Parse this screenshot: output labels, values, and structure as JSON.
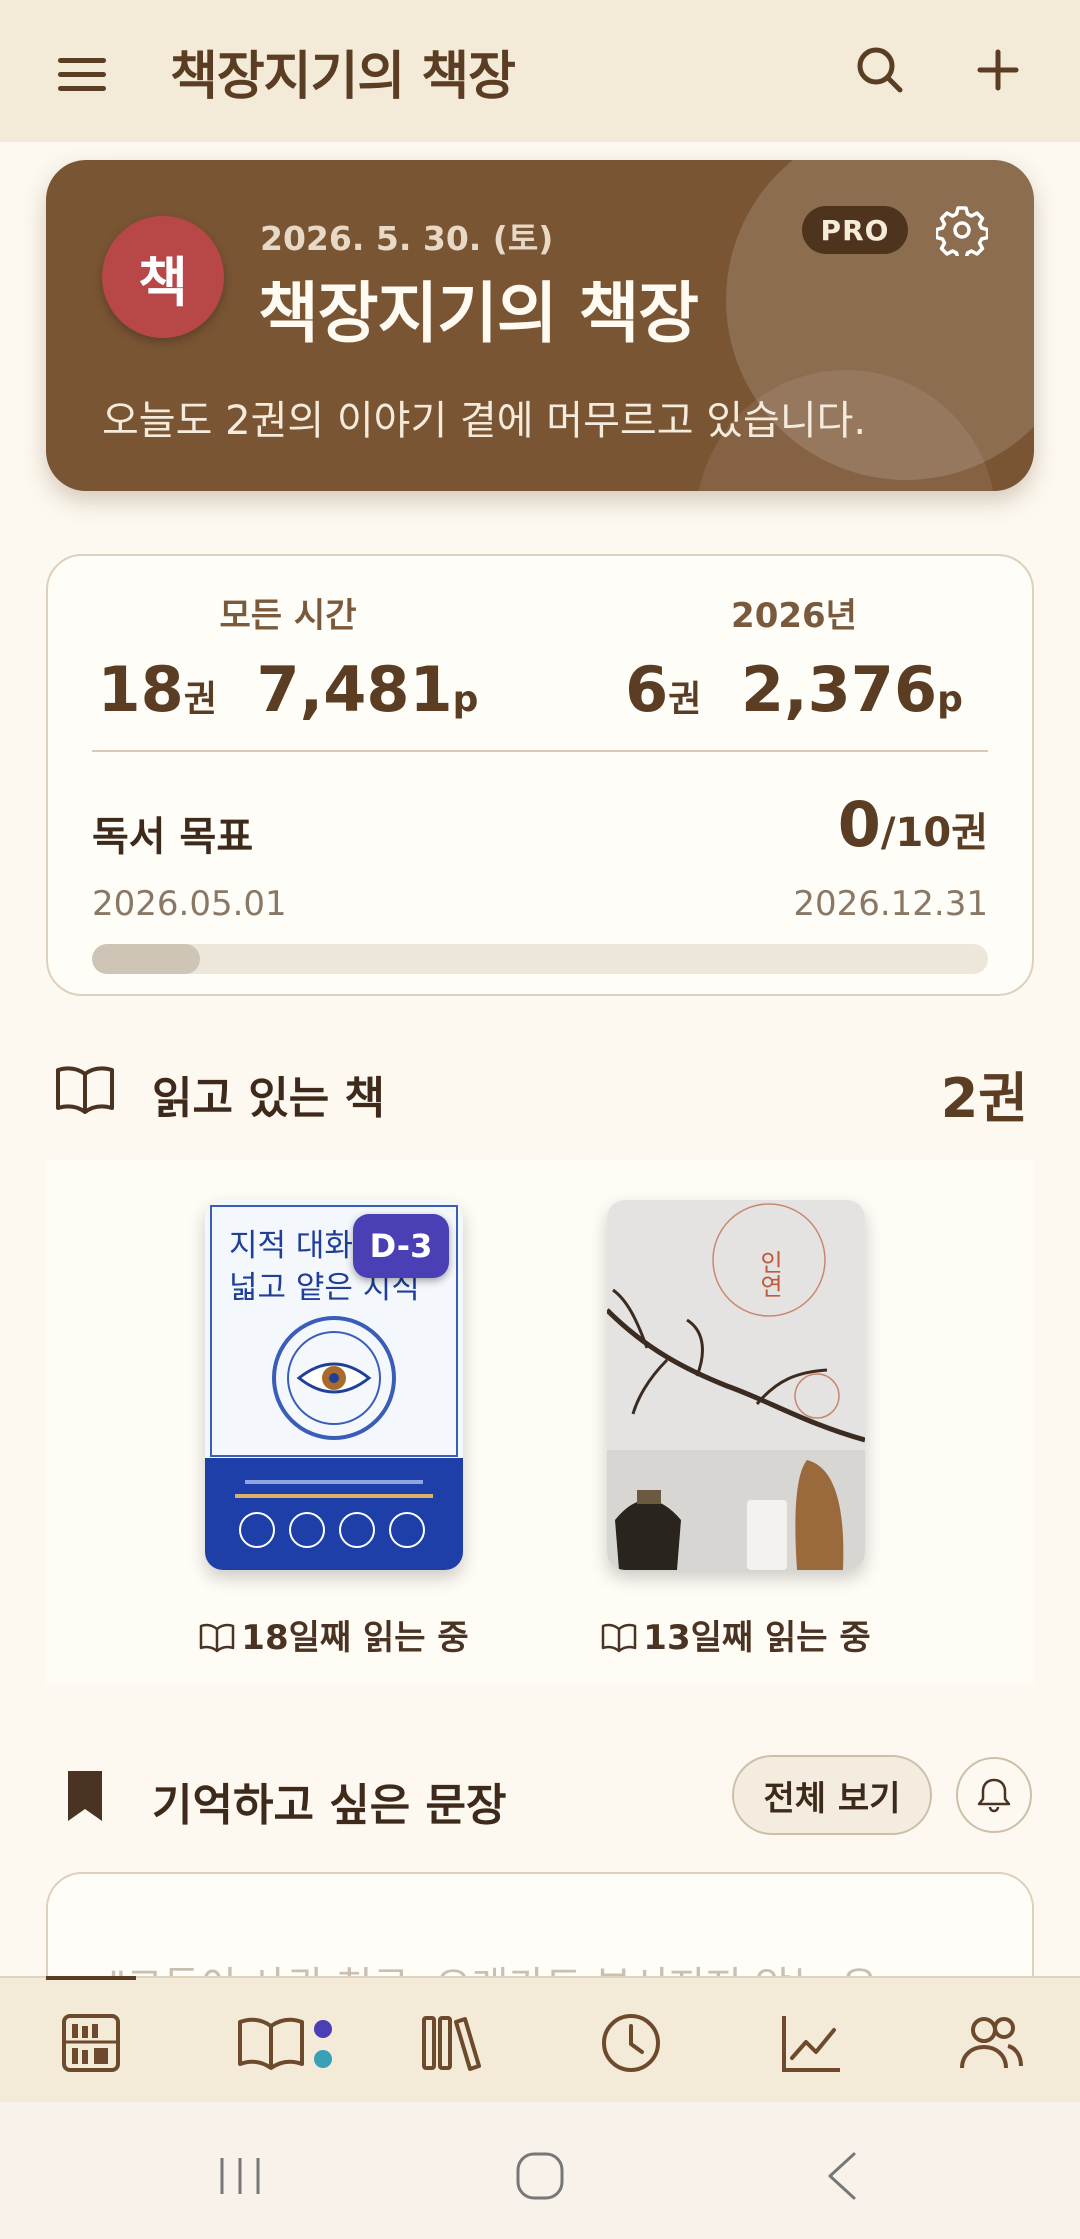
{
  "topbar": {
    "title": "책장지기의 책장",
    "icons": [
      "menu-icon",
      "search-icon",
      "plus-icon"
    ]
  },
  "hero": {
    "avatar_char": "책",
    "date": "2026. 5. 30. (토)",
    "name": "책장지기의 책장",
    "message": "오늘도 2권의 이야기 곁에 머무르고 있습니다.",
    "badge": "PRO",
    "colors": {
      "card": "#7a5534",
      "avatar": "#b84848"
    }
  },
  "stats": {
    "all_time": {
      "label": "모든 시간",
      "books": "18",
      "books_unit": "권",
      "pages": "7,481",
      "pages_unit": "p"
    },
    "this_year": {
      "label": "2026년",
      "books": "6",
      "books_unit": "권",
      "pages": "2,376",
      "pages_unit": "p"
    },
    "goal": {
      "title": "독서 목표",
      "current": "0",
      "target": "/10권",
      "start_date": "2026.05.01",
      "end_date": "2026.12.31",
      "progress": 0.12
    }
  },
  "reading": {
    "title": "읽고 있는 책",
    "count": "2권",
    "books": [
      {
        "badge": "D-3",
        "days": "18일째 읽는 중",
        "cover": {
          "title_line1": "지적 대화를 위한",
          "title_line2": "넓고 얕은 지식",
          "colors": {
            "top": "#f4f7fc",
            "bottom": "#1f3fa8",
            "ink": "#1f3f99"
          }
        }
      },
      {
        "days": "13일째 읽는 중",
        "cover": {
          "title": "인연",
          "colors": {
            "bg": "#e4e3e1",
            "ink": "#c05a3a"
          }
        }
      }
    ]
  },
  "quotes": {
    "title": "기억하고 싶은 문장",
    "view_all": "전체 보기",
    "preview": "\"그들이 사귄 친구, 오래가도 부서지지 않는 우"
  },
  "tabbar": {
    "tabs": [
      "bookshelf-icon",
      "reading-book-icon",
      "library-icon",
      "history-clock-icon",
      "stats-chart-icon",
      "friends-icon"
    ],
    "active": 0,
    "dot_colors": [
      "#4b3fb6",
      "#3aa0b8"
    ]
  },
  "system_nav": {
    "buttons": [
      "recent-apps-icon",
      "home-icon",
      "back-icon"
    ]
  }
}
